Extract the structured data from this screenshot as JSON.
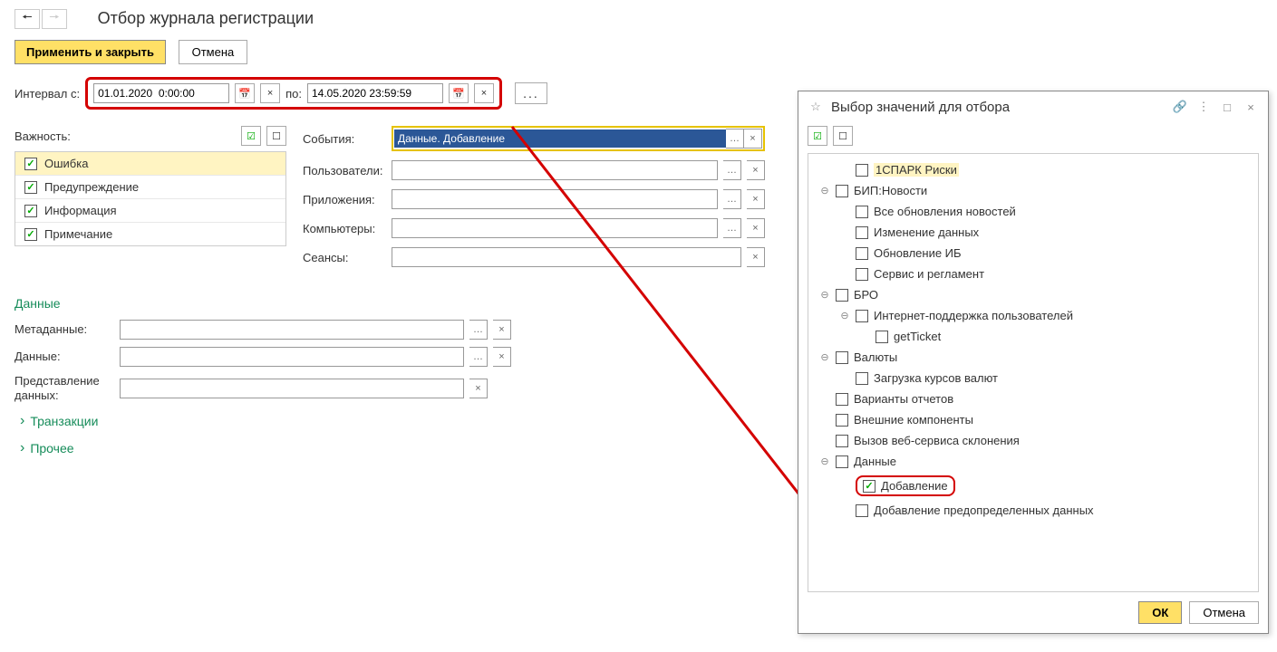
{
  "header": {
    "title": "Отбор журнала регистрации"
  },
  "toolbar": {
    "apply": "Применить и закрыть",
    "cancel": "Отмена"
  },
  "interval": {
    "label": "Интервал с:",
    "from": "01.01.2020  0:00:00",
    "to_label": "по:",
    "to": "14.05.2020 23:59:59"
  },
  "importance": {
    "label": "Важность:",
    "items": [
      "Ошибка",
      "Предупреждение",
      "Информация",
      "Примечание"
    ]
  },
  "fields": {
    "events_label": "События:",
    "events_value": "Данные. Добавление",
    "users_label": "Пользователи:",
    "apps_label": "Приложения:",
    "computers_label": "Компьютеры:",
    "sessions_label": "Сеансы:"
  },
  "data_section": {
    "title": "Данные",
    "metadata_label": "Метаданные:",
    "data_label": "Данные:",
    "repr_label": "Представление\nданных:"
  },
  "links": {
    "transactions": "Транзакции",
    "other": "Прочее"
  },
  "dialog": {
    "title": "Выбор значений для отбора",
    "ok": "ОК",
    "cancel": "Отмена",
    "tree": [
      {
        "indent": 1,
        "toggle": "",
        "checked": false,
        "label": "1СПАРК Риски",
        "hl": true
      },
      {
        "indent": 0,
        "toggle": "⊖",
        "checked": false,
        "label": "БИП:Новости"
      },
      {
        "indent": 1,
        "toggle": "",
        "checked": false,
        "label": "Все обновления новостей"
      },
      {
        "indent": 1,
        "toggle": "",
        "checked": false,
        "label": "Изменение данных"
      },
      {
        "indent": 1,
        "toggle": "",
        "checked": false,
        "label": "Обновление ИБ"
      },
      {
        "indent": 1,
        "toggle": "",
        "checked": false,
        "label": "Сервис и регламент"
      },
      {
        "indent": 0,
        "toggle": "⊖",
        "checked": false,
        "label": "БРО"
      },
      {
        "indent": 1,
        "toggle": "⊖",
        "checked": false,
        "label": "Интернет-поддержка пользователей"
      },
      {
        "indent": 2,
        "toggle": "",
        "checked": false,
        "label": "getTicket"
      },
      {
        "indent": 0,
        "toggle": "⊖",
        "checked": false,
        "label": "Валюты"
      },
      {
        "indent": 1,
        "toggle": "",
        "checked": false,
        "label": "Загрузка курсов валют"
      },
      {
        "indent": 0,
        "toggle": "",
        "checked": false,
        "label": "Варианты отчетов"
      },
      {
        "indent": 0,
        "toggle": "",
        "checked": false,
        "label": "Внешние компоненты"
      },
      {
        "indent": 0,
        "toggle": "",
        "checked": false,
        "label": "Вызов веб-сервиса склонения"
      },
      {
        "indent": 0,
        "toggle": "⊖",
        "checked": false,
        "label": "Данные"
      },
      {
        "indent": 1,
        "toggle": "",
        "checked": true,
        "label": "Добавление",
        "red": true
      },
      {
        "indent": 1,
        "toggle": "",
        "checked": false,
        "label": "Добавление предопределенных данных"
      }
    ]
  }
}
